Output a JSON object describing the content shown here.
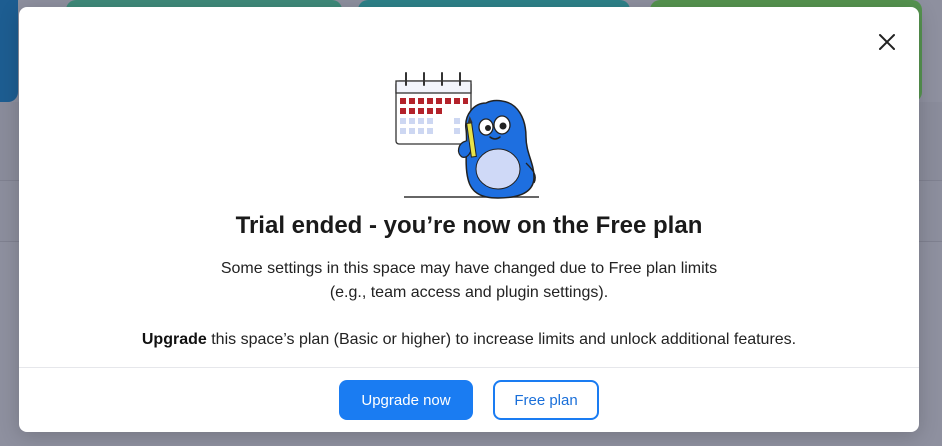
{
  "modal": {
    "title": "Trial ended - you’re now on the Free plan",
    "desc_line1": "Some settings in this space may have changed due to Free plan limits",
    "desc_line2": "(e.g., team access and plugin settings).",
    "upgrade_bold": "Upgrade",
    "upgrade_rest": " this space’s plan (Basic or higher) to increase limits and unlock additional features.",
    "close_icon": "close-icon",
    "illustration": "calendar-mascot-illustration"
  },
  "buttons": {
    "upgrade_label": "Upgrade now",
    "free_label": "Free plan"
  },
  "colors": {
    "primary": "#1a7cf2",
    "overlay": "#8e909f",
    "mascot": "#1e6fe0"
  }
}
